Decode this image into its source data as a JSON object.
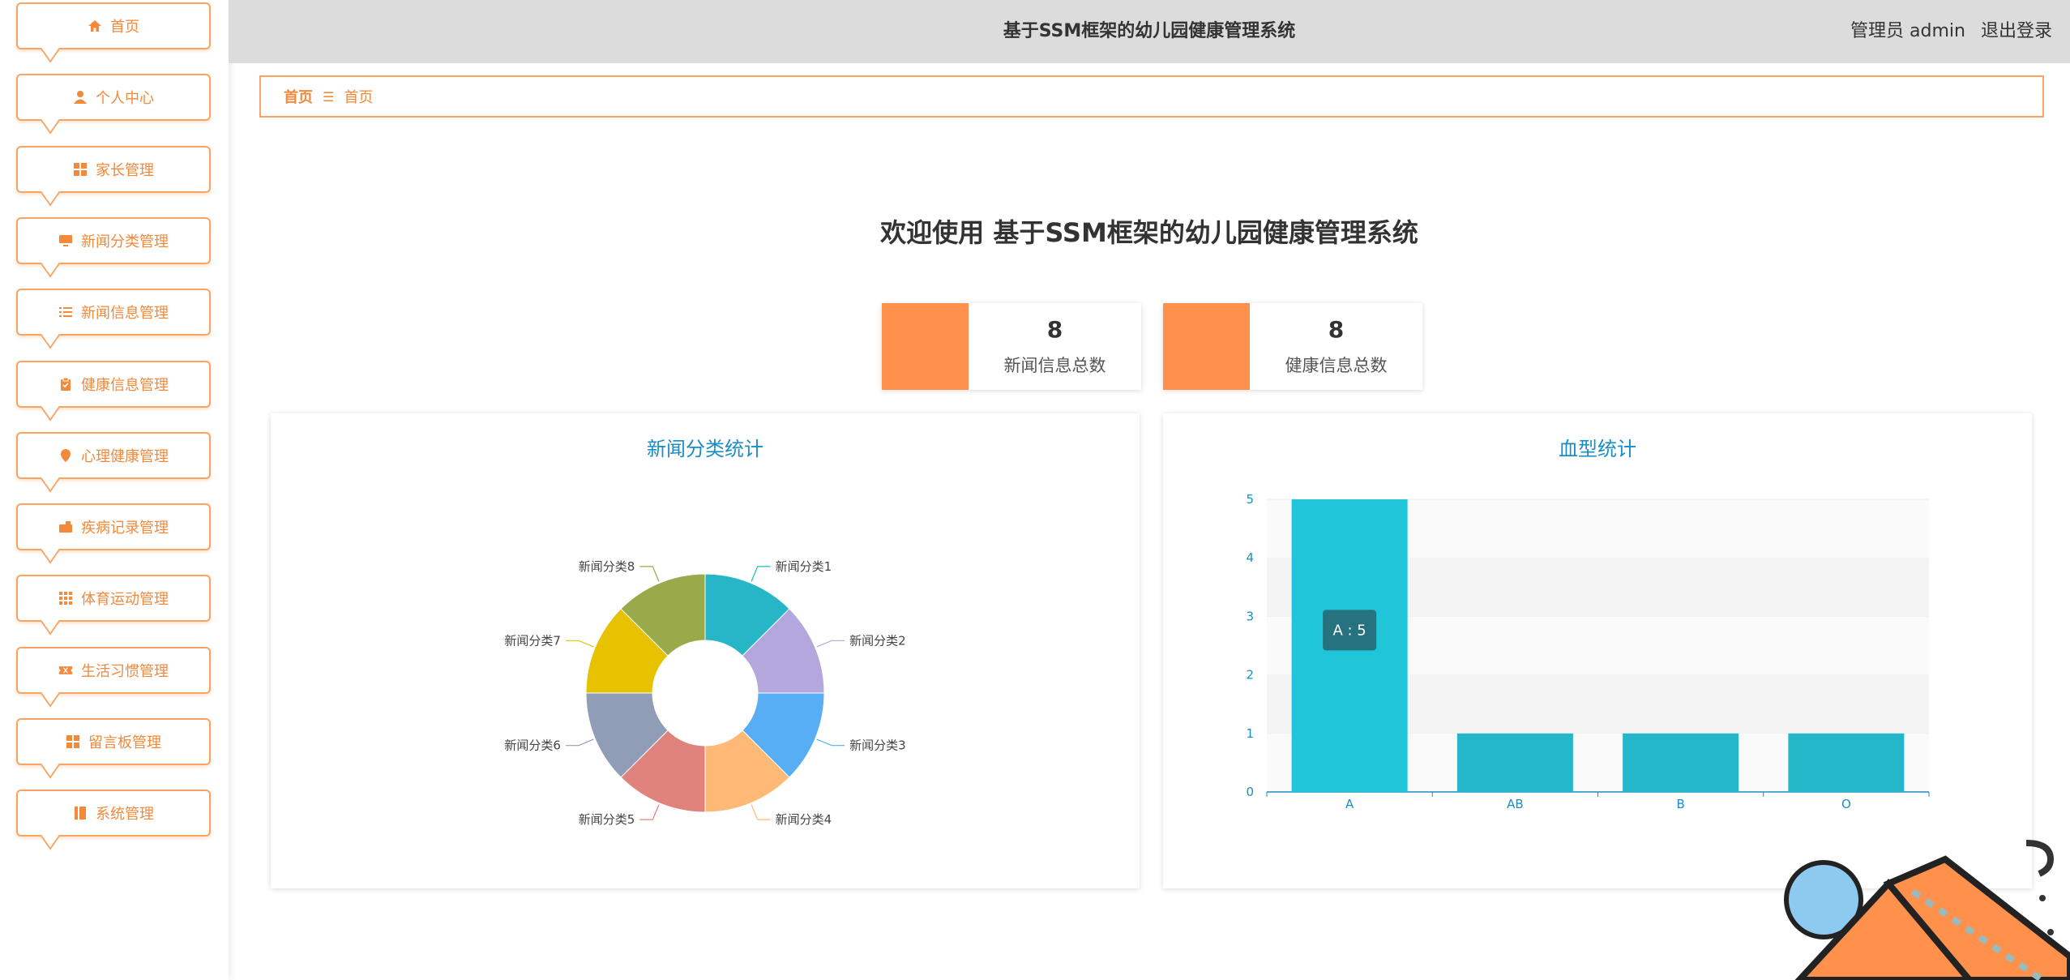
{
  "sidebar": {
    "items": [
      {
        "label": "首页",
        "icon": "home-icon"
      },
      {
        "label": "个人中心",
        "icon": "user-icon"
      },
      {
        "label": "家长管理",
        "icon": "grid-icon"
      },
      {
        "label": "新闻分类管理",
        "icon": "monitor-icon"
      },
      {
        "label": "新闻信息管理",
        "icon": "list-icon"
      },
      {
        "label": "健康信息管理",
        "icon": "clipboard-icon"
      },
      {
        "label": "心理健康管理",
        "icon": "pin-icon"
      },
      {
        "label": "疾病记录管理",
        "icon": "briefcase-icon"
      },
      {
        "label": "体育运动管理",
        "icon": "apps-icon"
      },
      {
        "label": "生活习惯管理",
        "icon": "ticket-icon"
      },
      {
        "label": "留言板管理",
        "icon": "grid-icon"
      },
      {
        "label": "系统管理",
        "icon": "book-icon"
      }
    ]
  },
  "header": {
    "title": "基于SSM框架的幼儿园健康管理系统",
    "user_label": "管理员 admin",
    "logout_label": "退出登录"
  },
  "breadcrumb": {
    "root": "首页",
    "separator": "☰",
    "current": "首页"
  },
  "welcome": "欢迎使用 基于SSM框架的幼儿园健康管理系统",
  "stats": [
    {
      "value": "8",
      "label": "新闻信息总数",
      "color": "#ff914d"
    },
    {
      "value": "8",
      "label": "健康信息总数",
      "color": "#ff914d"
    }
  ],
  "chart_data": [
    {
      "type": "pie",
      "title": "新闻分类统计",
      "donut": true,
      "categories": [
        "新闻分类1",
        "新闻分类2",
        "新闻分类3",
        "新闻分类4",
        "新闻分类5",
        "新闻分类6",
        "新闻分类7",
        "新闻分类8"
      ],
      "values": [
        1,
        1,
        1,
        1,
        1,
        1,
        1,
        1
      ],
      "colors": [
        "#26b6c8",
        "#b3a7de",
        "#58aef4",
        "#ffb977",
        "#e0837c",
        "#8f9db6",
        "#e6c200",
        "#9aaa4b"
      ]
    },
    {
      "type": "bar",
      "title": "血型统计",
      "categories": [
        "A",
        "AB",
        "B",
        "O"
      ],
      "values": [
        5,
        1,
        1,
        1
      ],
      "ylim": [
        0,
        5
      ],
      "yticks": [
        0,
        1,
        2,
        3,
        4,
        5
      ],
      "bar_color": "#24b6c9",
      "highlight_color": "#20c5d9",
      "tooltip": "A : 5"
    }
  ]
}
